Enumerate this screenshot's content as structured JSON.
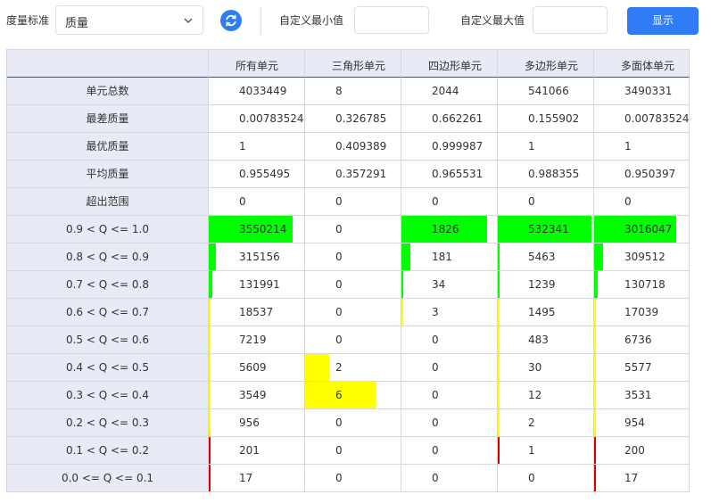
{
  "toolbar": {
    "metric_label": "度量标准",
    "metric_value": "质量",
    "min_label": "自定义最小值",
    "max_label": "自定义最大值",
    "min_value": "",
    "max_value": "",
    "show_button": "显示"
  },
  "colors": {
    "accent": "#2f7cf6",
    "header_bg": "#e8eaf6",
    "green": "#00ff00",
    "yellow": "#ffff00",
    "red": "#e00000"
  },
  "columns": [
    "所有单元",
    "三角形单元",
    "四边形单元",
    "多边形单元",
    "多面体单元"
  ],
  "rows": [
    {
      "label": "单元总数",
      "values": [
        "4033449",
        "8",
        "2044",
        "541066",
        "3490331"
      ]
    },
    {
      "label": "最差质量",
      "values": [
        "0.00783524",
        "0.326785",
        "0.662261",
        "0.155902",
        "0.00783524"
      ]
    },
    {
      "label": "最优质量",
      "values": [
        "1",
        "0.409389",
        "0.999987",
        "1",
        "1"
      ]
    },
    {
      "label": "平均质量",
      "values": [
        "0.955495",
        "0.357291",
        "0.965531",
        "0.988355",
        "0.950397"
      ]
    },
    {
      "label": "超出范围",
      "values": [
        "0",
        "0",
        "0",
        "0",
        "0"
      ]
    },
    {
      "label": "0.9 < Q <= 1.0",
      "values": [
        "3550214",
        "0",
        "1826",
        "532341",
        "3016047"
      ],
      "bar_color": "#00ff00",
      "fractions": [
        0.88,
        0,
        0.893,
        0.984,
        0.864
      ]
    },
    {
      "label": "0.8 < Q <= 0.9",
      "values": [
        "315156",
        "0",
        "181",
        "5463",
        "309512"
      ],
      "bar_color": "#00ff00",
      "fractions": [
        0.078,
        0,
        0.089,
        0.01,
        0.089
      ]
    },
    {
      "label": "0.7 < Q <= 0.8",
      "values": [
        "131991",
        "0",
        "34",
        "1239",
        "130718"
      ],
      "bar_color": "#00ff00",
      "fractions": [
        0.033,
        0,
        0.017,
        0.002,
        0.037
      ]
    },
    {
      "label": "0.6 < Q <= 0.7",
      "values": [
        "18537",
        "0",
        "3",
        "1495",
        "17039"
      ],
      "bar_color": "#ffff00",
      "fractions": [
        0.005,
        0,
        0.0015,
        0.003,
        0.005
      ]
    },
    {
      "label": "0.5 < Q <= 0.6",
      "values": [
        "7219",
        "0",
        "0",
        "483",
        "6736"
      ],
      "bar_color": "#ffff00",
      "fractions": [
        0.002,
        0,
        0,
        0.001,
        0.002
      ]
    },
    {
      "label": "0.4 < Q <= 0.5",
      "values": [
        "5609",
        "2",
        "0",
        "30",
        "5577"
      ],
      "bar_color": "#ffff00",
      "fractions": [
        0.0014,
        0.25,
        0,
        0.0001,
        0.0016
      ]
    },
    {
      "label": "0.3 < Q <= 0.4",
      "values": [
        "3549",
        "6",
        "0",
        "12",
        "3531"
      ],
      "bar_color": "#ffff00",
      "fractions": [
        0.0009,
        0.75,
        0,
        2e-05,
        0.001
      ]
    },
    {
      "label": "0.2 < Q <= 0.3",
      "values": [
        "956",
        "0",
        "0",
        "2",
        "954"
      ],
      "bar_color": "#ffff00",
      "fractions": [
        0.0002,
        0,
        0,
        4e-06,
        0.0003
      ]
    },
    {
      "label": "0.1 < Q <= 0.2",
      "values": [
        "201",
        "0",
        "0",
        "1",
        "200"
      ],
      "bar_color": "#e00000",
      "fractions": [
        5e-05,
        0,
        0,
        2e-06,
        6e-05
      ]
    },
    {
      "label": "0.0 <= Q <= 0.1",
      "values": [
        "17",
        "0",
        "0",
        "0",
        "17"
      ],
      "bar_color": "#e00000",
      "fractions": [
        4e-06,
        0,
        0,
        0,
        5e-06
      ]
    }
  ]
}
